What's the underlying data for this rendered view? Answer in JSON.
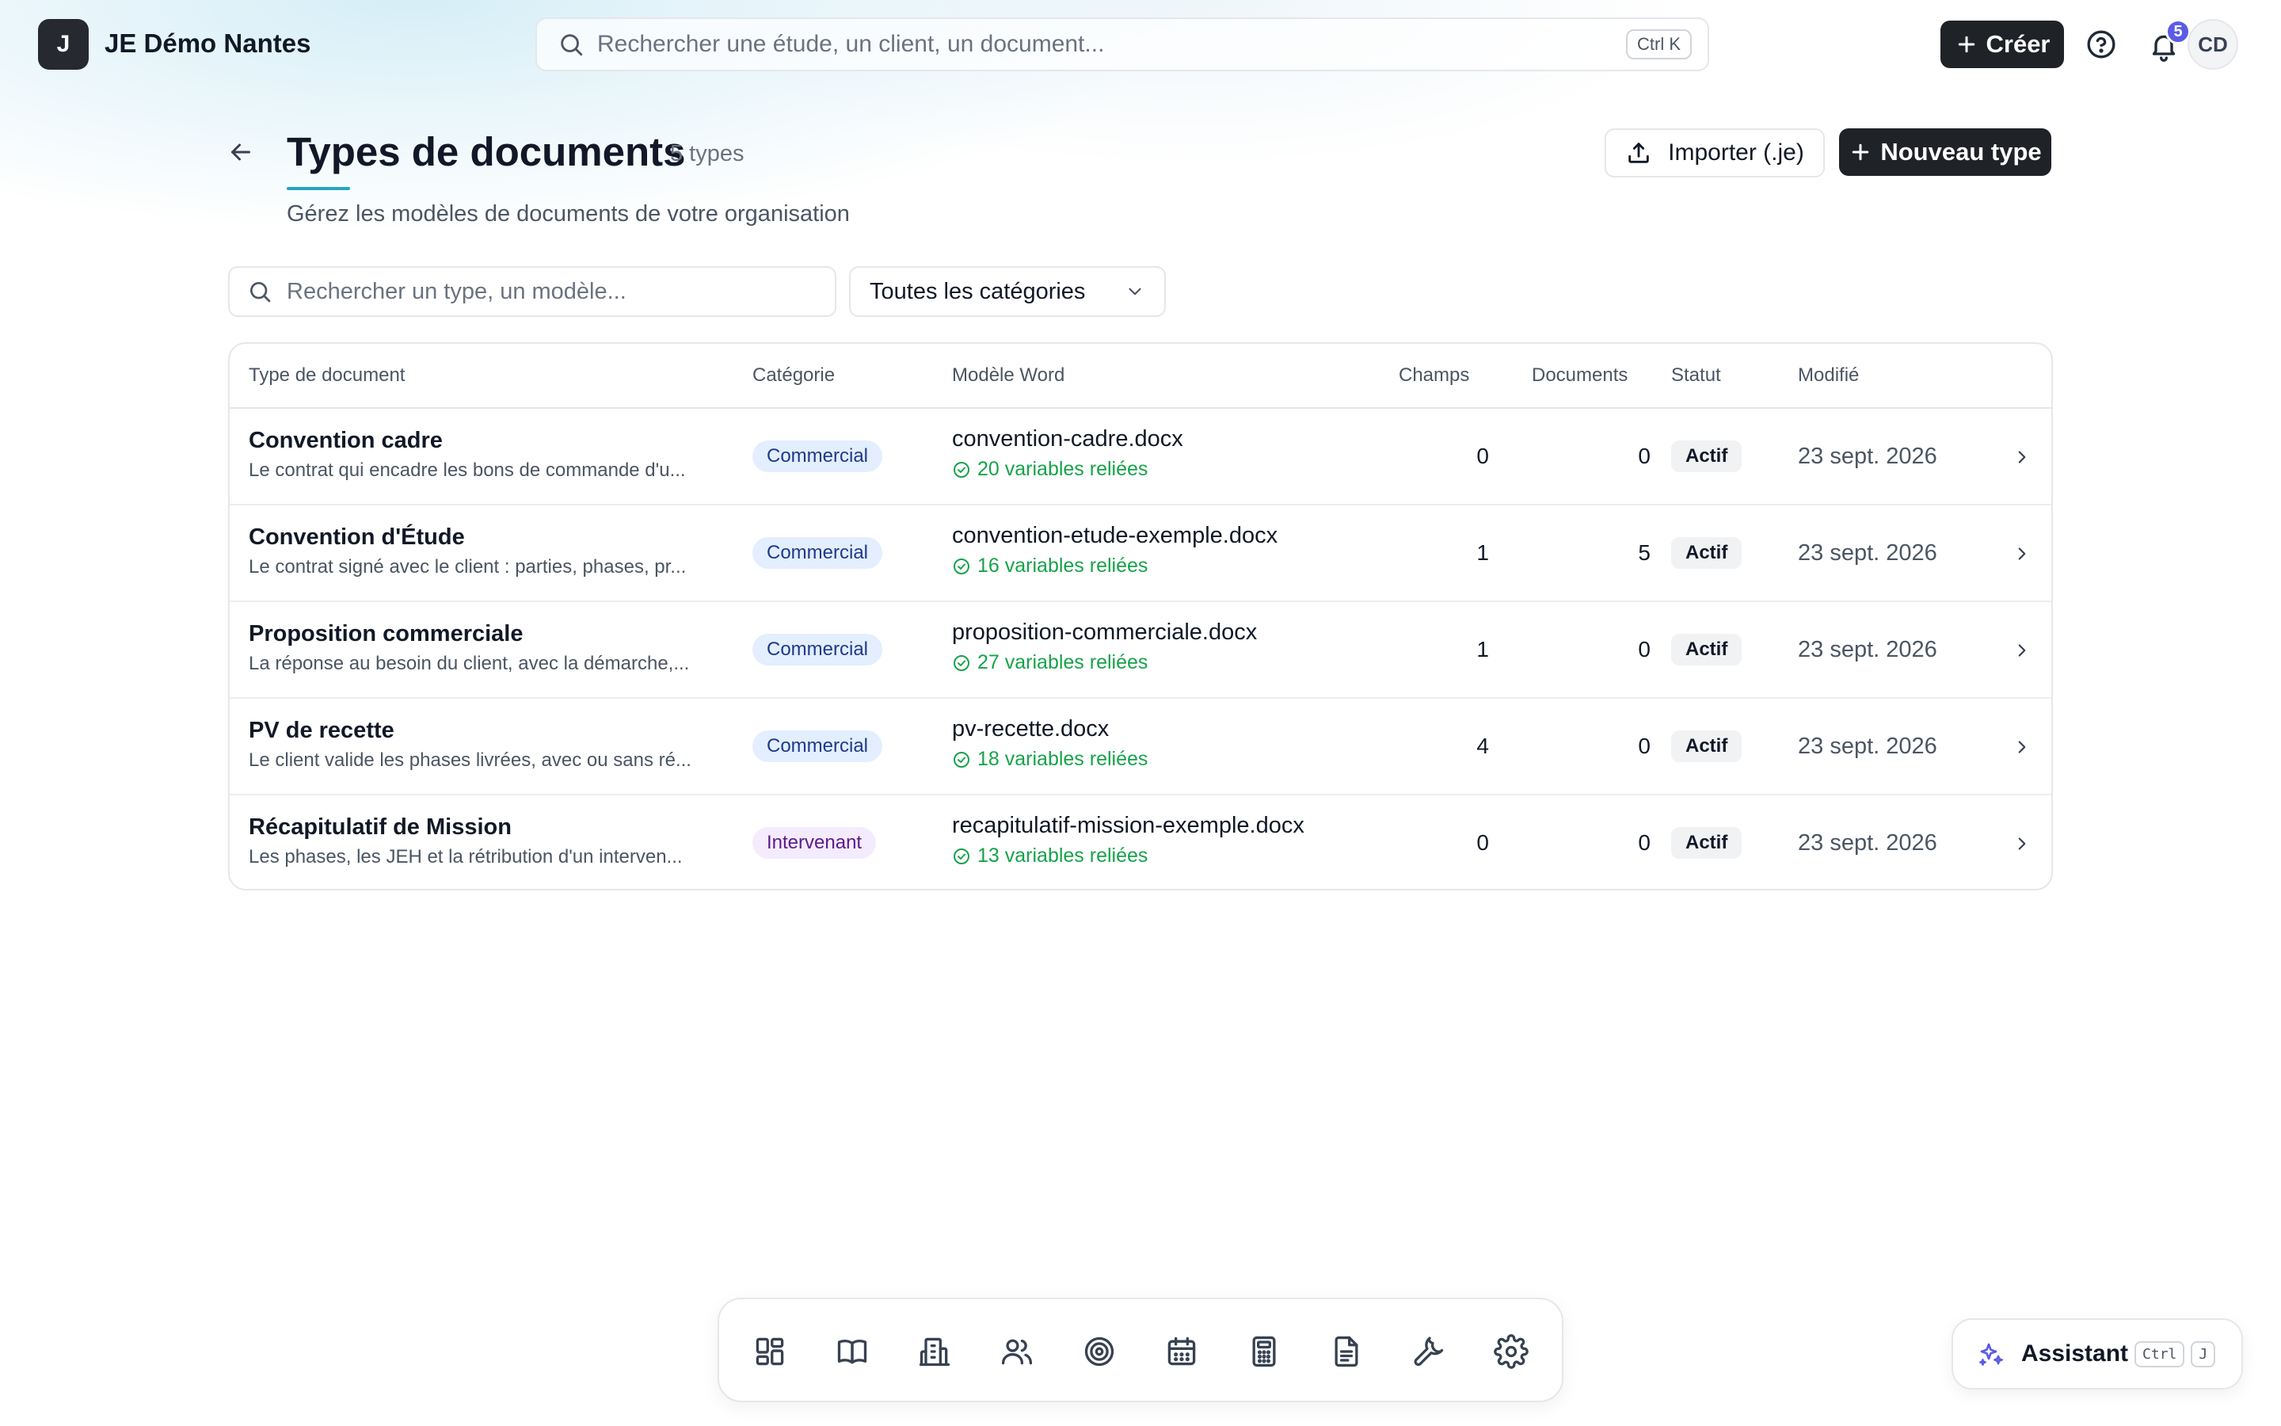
{
  "header": {
    "org_initial": "J",
    "org_name": "JE Démo Nantes",
    "search_placeholder": "Rechercher une étude, un client, un document...",
    "search_shortcut": "Ctrl K",
    "create_label": "Créer",
    "notification_count": "5",
    "avatar_initials": "CD"
  },
  "page": {
    "title": "Types de documents",
    "count_label": "5 types",
    "subtitle": "Gérez les modèles de documents de votre organisation",
    "import_label": "Importer (.je)",
    "new_type_label": "Nouveau type"
  },
  "filters": {
    "search_placeholder": "Rechercher un type, un modèle...",
    "category_selected": "Toutes les catégories"
  },
  "table": {
    "columns": [
      "Type de document",
      "Catégorie",
      "Modèle Word",
      "Champs",
      "Documents",
      "Statut",
      "Modifié"
    ],
    "rows": [
      {
        "name": "Convention cadre",
        "description": "Le contrat qui encadre les bons de commande d'u...",
        "category": "Commercial",
        "template": "convention-cadre.docx",
        "variables": "20 variables reliées",
        "fields": "0",
        "documents": "0",
        "status": "Actif",
        "modified": "23 sept. 2026"
      },
      {
        "name": "Convention d'Étude",
        "description": "Le contrat signé avec le client : parties, phases, pr...",
        "category": "Commercial",
        "template": "convention-etude-exemple.docx",
        "variables": "16 variables reliées",
        "fields": "1",
        "documents": "5",
        "status": "Actif",
        "modified": "23 sept. 2026"
      },
      {
        "name": "Proposition commerciale",
        "description": "La réponse au besoin du client, avec la démarche,...",
        "category": "Commercial",
        "template": "proposition-commerciale.docx",
        "variables": "27 variables reliées",
        "fields": "1",
        "documents": "0",
        "status": "Actif",
        "modified": "23 sept. 2026"
      },
      {
        "name": "PV de recette",
        "description": "Le client valide les phases livrées, avec ou sans ré...",
        "category": "Commercial",
        "template": "pv-recette.docx",
        "variables": "18 variables reliées",
        "fields": "4",
        "documents": "0",
        "status": "Actif",
        "modified": "23 sept. 2026"
      },
      {
        "name": "Récapitulatif de Mission",
        "description": "Les phases, les JEH et la rétribution d'un interven...",
        "category": "Intervenant",
        "template": "recapitulatif-mission-exemple.docx",
        "variables": "13 variables reliées",
        "fields": "0",
        "documents": "0",
        "status": "Actif",
        "modified": "23 sept. 2026"
      }
    ]
  },
  "dock": {
    "items": [
      "dashboard-icon",
      "book-icon",
      "building-icon",
      "users-icon",
      "target-icon",
      "calendar-icon",
      "calculator-icon",
      "document-icon",
      "wrench-icon",
      "settings-icon"
    ]
  },
  "assistant": {
    "label": "Assistant",
    "shortcut_key1": "Ctrl",
    "shortcut_key2": "J"
  },
  "colors": {
    "accent": "#22a5c4",
    "primary_button": "#1f2226",
    "notification": "#5b5ce6",
    "success": "#16a34a",
    "commercial_bg": "#e3eefe",
    "intervenant_bg": "#f4ebfd"
  }
}
